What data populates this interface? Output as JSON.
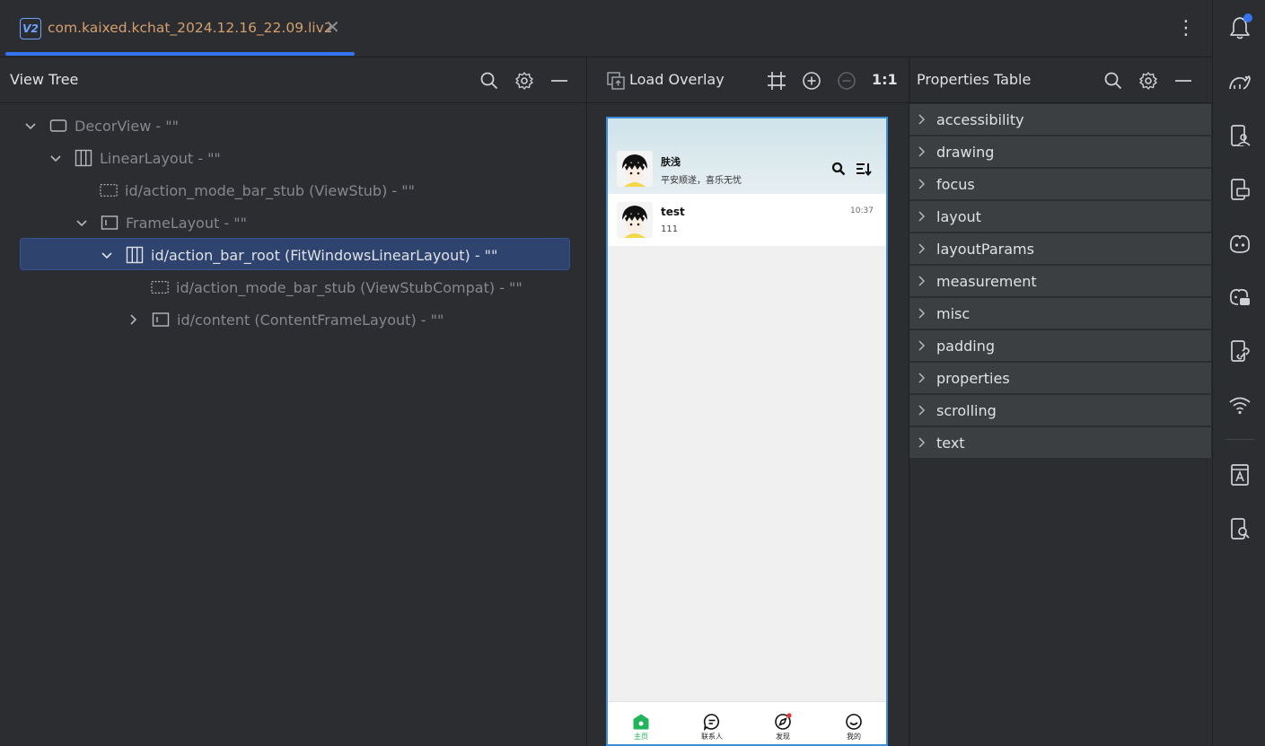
{
  "tab": {
    "badge": "V2",
    "title": "com.kaixed.kchat_2024.12.16_22.09.liv2",
    "close": "✕",
    "more": "⋮"
  },
  "viewtree": {
    "title": "View Tree",
    "nodes": [
      {
        "label": "DecorView - \"\""
      },
      {
        "label": "LinearLayout - \"\""
      },
      {
        "label": "id/action_mode_bar_stub (ViewStub) - \"\""
      },
      {
        "label": "FrameLayout - \"\""
      },
      {
        "label": "id/action_bar_root (FitWindowsLinearLayout) - \"\""
      },
      {
        "label": "id/action_mode_bar_stub (ViewStubCompat) - \"\""
      },
      {
        "label": "id/content (ContentFrameLayout) - \"\""
      }
    ]
  },
  "preview": {
    "load_overlay": "Load Overlay",
    "zoom": "1:1"
  },
  "phone": {
    "user_name": "肤浅",
    "user_status": "平安顺遂，喜乐无忧",
    "chat": {
      "name": "test",
      "message": "111",
      "time": "10:37"
    },
    "nav": [
      {
        "label": "主页"
      },
      {
        "label": "联系人"
      },
      {
        "label": "发现"
      },
      {
        "label": "我的"
      }
    ]
  },
  "properties": {
    "title": "Properties Table",
    "groups": [
      "accessibility",
      "drawing",
      "focus",
      "layout",
      "layoutParams",
      "measurement",
      "misc",
      "padding",
      "properties",
      "scrolling",
      "text"
    ]
  },
  "colors": {
    "accent": "#3574f0",
    "selection": "#2e436e",
    "tab_title": "#d59f6e",
    "nav_active": "#21b45a"
  }
}
